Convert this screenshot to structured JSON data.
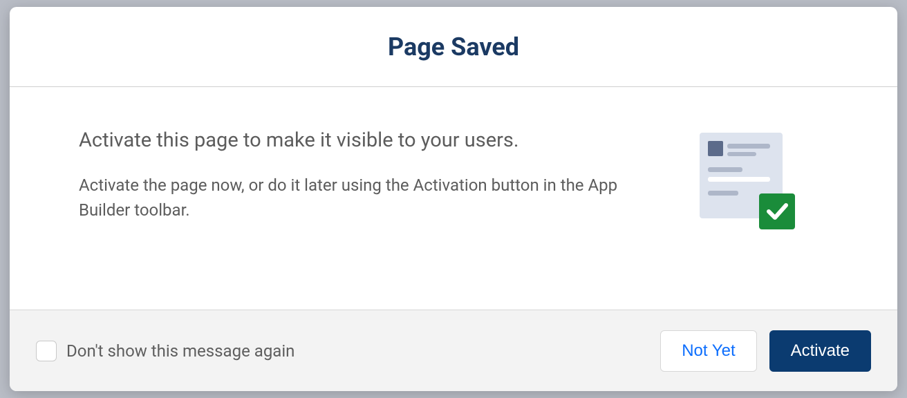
{
  "modal": {
    "title": "Page Saved",
    "headline": "Activate this page to make it visible to your users.",
    "description": "Activate the page now, or do it later using the Activation button in the App Builder toolbar.",
    "illustration_alt": "page-activated-illustration"
  },
  "footer": {
    "checkbox_label": "Don't show this message again",
    "secondary_label": "Not Yet",
    "primary_label": "Activate"
  },
  "colors": {
    "primary_button": "#0b3b70",
    "link": "#0d6efd",
    "title": "#1b3a63",
    "success_badge": "#1a8c3a"
  }
}
